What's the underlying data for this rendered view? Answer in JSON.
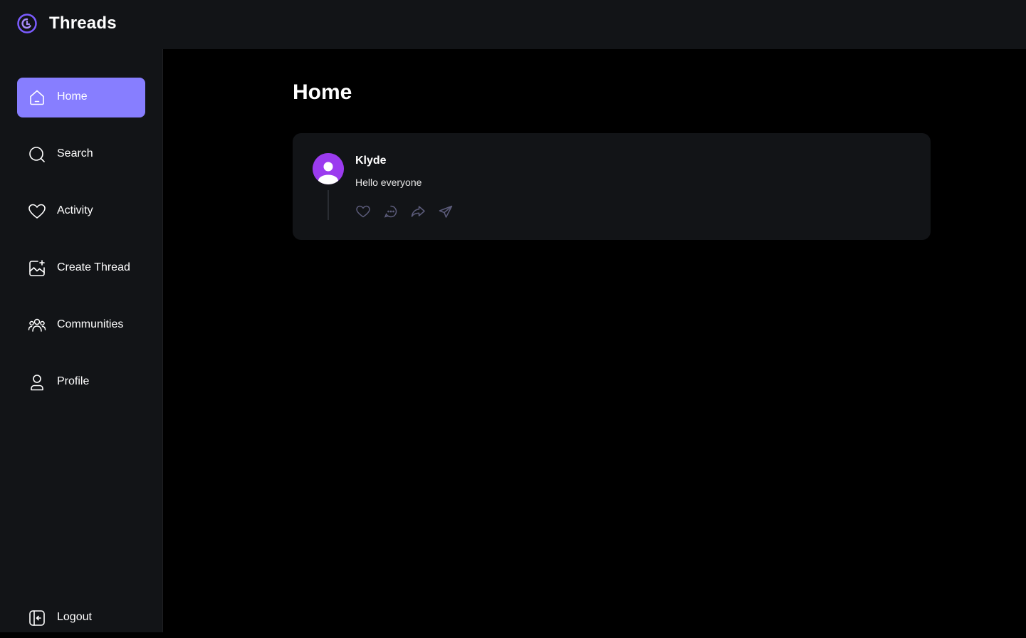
{
  "app": {
    "title": "Threads"
  },
  "sidebar": {
    "items": [
      {
        "label": "Home",
        "icon": "home-icon",
        "active": true
      },
      {
        "label": "Search",
        "icon": "search-icon",
        "active": false
      },
      {
        "label": "Activity",
        "icon": "heart-icon",
        "active": false
      },
      {
        "label": "Create Thread",
        "icon": "create-thread-icon",
        "active": false
      },
      {
        "label": "Communities",
        "icon": "communities-icon",
        "active": false
      },
      {
        "label": "Profile",
        "icon": "profile-icon",
        "active": false
      }
    ],
    "logout_label": "Logout"
  },
  "main": {
    "title": "Home",
    "threads": [
      {
        "author": "Klyde",
        "content": "Hello everyone",
        "actions": [
          "heart-icon",
          "reply-icon",
          "repost-icon",
          "share-icon"
        ]
      }
    ]
  },
  "colors": {
    "accent": "#877eff",
    "panel": "#121417",
    "background": "#000000",
    "avatar": "#9b3bef"
  }
}
